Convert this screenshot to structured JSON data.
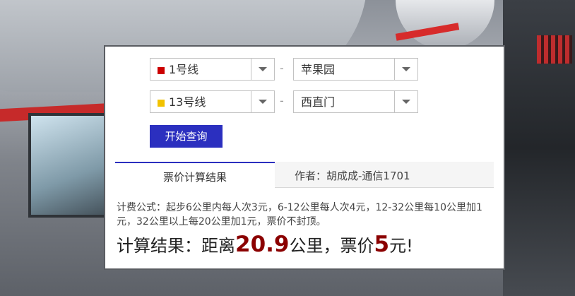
{
  "form": {
    "line_from": {
      "label": "1号线",
      "color": "#cc0000"
    },
    "station_from": {
      "label": "苹果园"
    },
    "line_to": {
      "label": "13号线",
      "color": "#f2c200"
    },
    "station_to": {
      "label": "西直门"
    },
    "separator": "-",
    "query_button": "开始查询"
  },
  "tabs": {
    "result_tab": "票价计算结果",
    "author_tab": "作者：胡成成-通信1701"
  },
  "content": {
    "formula": "计费公式：起步6公里内每人次3元，6-12公里每人次4元，12-32公里每10公里加1元，32公里以上每20公里加1元，票价不封顶。",
    "result_prefix": "计算结果：距离",
    "distance": "20.9",
    "result_mid": "公里，票价",
    "price": "5",
    "result_suffix": "元!"
  }
}
